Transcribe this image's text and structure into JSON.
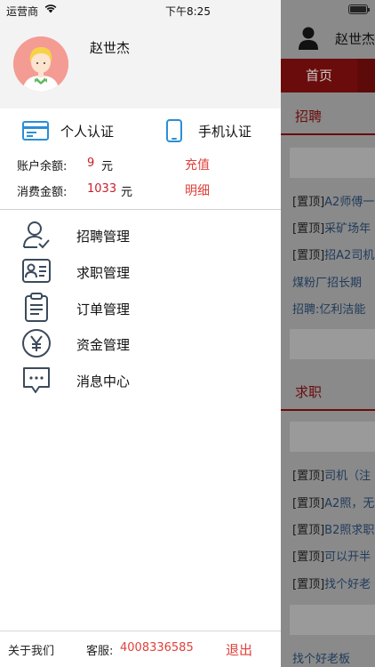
{
  "status_bar": {
    "carrier": "运营商",
    "time": "下午8:25"
  },
  "profile": {
    "username": "赵世杰"
  },
  "verify": {
    "personal": "个人认证",
    "phone": "手机认证"
  },
  "account": {
    "balance_label": "账户余额:",
    "balance_value": "9",
    "balance_unit": "元",
    "recharge": "充值",
    "spend_label": "消费金额:",
    "spend_value": "1033",
    "spend_unit": "元",
    "details": "明细"
  },
  "menu": [
    {
      "label": "招聘管理",
      "icon": "user-check-icon"
    },
    {
      "label": "求职管理",
      "icon": "id-card-icon"
    },
    {
      "label": "订单管理",
      "icon": "clipboard-icon"
    },
    {
      "label": "资金管理",
      "icon": "yen-circle-icon"
    },
    {
      "label": "消息中心",
      "icon": "message-icon"
    }
  ],
  "footer": {
    "about": "关于我们",
    "service_label": "客服:",
    "service_phone": "4008336585",
    "logout": "退出"
  },
  "background": {
    "username": "赵世杰",
    "tab_home": "首页",
    "recruit_title": "招聘",
    "recruit_items": [
      {
        "tag": "[置顶]",
        "text": "A2师傅一"
      },
      {
        "tag": "[置顶]",
        "text": "采矿场年"
      },
      {
        "tag": "[置顶]",
        "text": "招A2司机"
      },
      {
        "tag": "",
        "text": "煤粉厂招长期"
      },
      {
        "tag": "",
        "text": "招聘:亿利洁能"
      }
    ],
    "jobseek_title": "求职",
    "jobseek_items": [
      {
        "tag": "[置顶]",
        "text": "司机（注"
      },
      {
        "tag": "[置顶]",
        "text": "A2照，无"
      },
      {
        "tag": "[置顶]",
        "text": "B2照求职"
      },
      {
        "tag": "[置顶]",
        "text": "可以开半"
      },
      {
        "tag": "[置顶]",
        "text": "找个好老"
      }
    ],
    "last_item": "找个好老板"
  },
  "colors": {
    "accent": "#e0413b",
    "value_red": "#c8202a",
    "brand_dark_red": "#6b0c0c",
    "icon_blue": "#2a8fd6",
    "icon_navy": "#3b4a5c"
  }
}
